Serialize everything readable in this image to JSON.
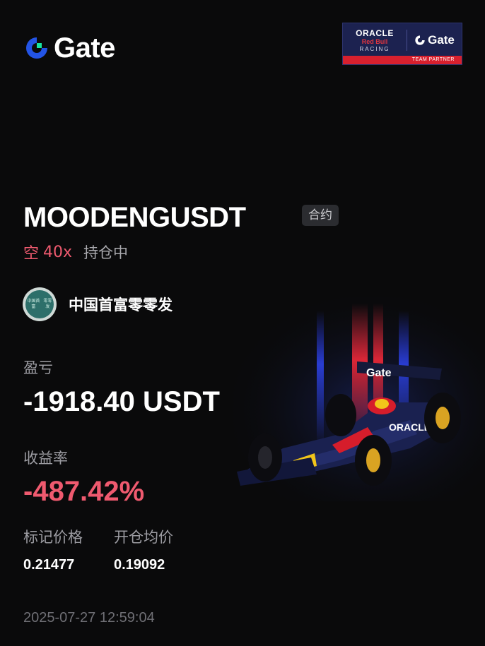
{
  "header": {
    "brand_name": "Gate",
    "brand_color": "#2354e6",
    "brand_accent": "#17e6a1"
  },
  "partner_badge": {
    "oracle": "ORACLE",
    "red_bull": "Red Bull",
    "racing": "RACING",
    "gate": "Gate",
    "strip": "TEAM PARTNER"
  },
  "position": {
    "symbol": "MOODENGUSDT",
    "type_tag": "合约",
    "side": "空",
    "leverage": "40x",
    "status": "持仓中"
  },
  "user": {
    "avatar_text_line1": "中国首富",
    "avatar_text_line2": "零零发",
    "name": "中国首富零零发"
  },
  "pnl": {
    "label": "盈亏",
    "value": "-1918.40 USDT"
  },
  "roi": {
    "label": "收益率",
    "value": "-487.42%",
    "color": "#ef5a6f"
  },
  "prices": {
    "mark_label": "标记价格",
    "mark_value": "0.21477",
    "entry_label": "开仓均价",
    "entry_value": "0.19092"
  },
  "timestamp": "2025-07-27 12:59:04"
}
